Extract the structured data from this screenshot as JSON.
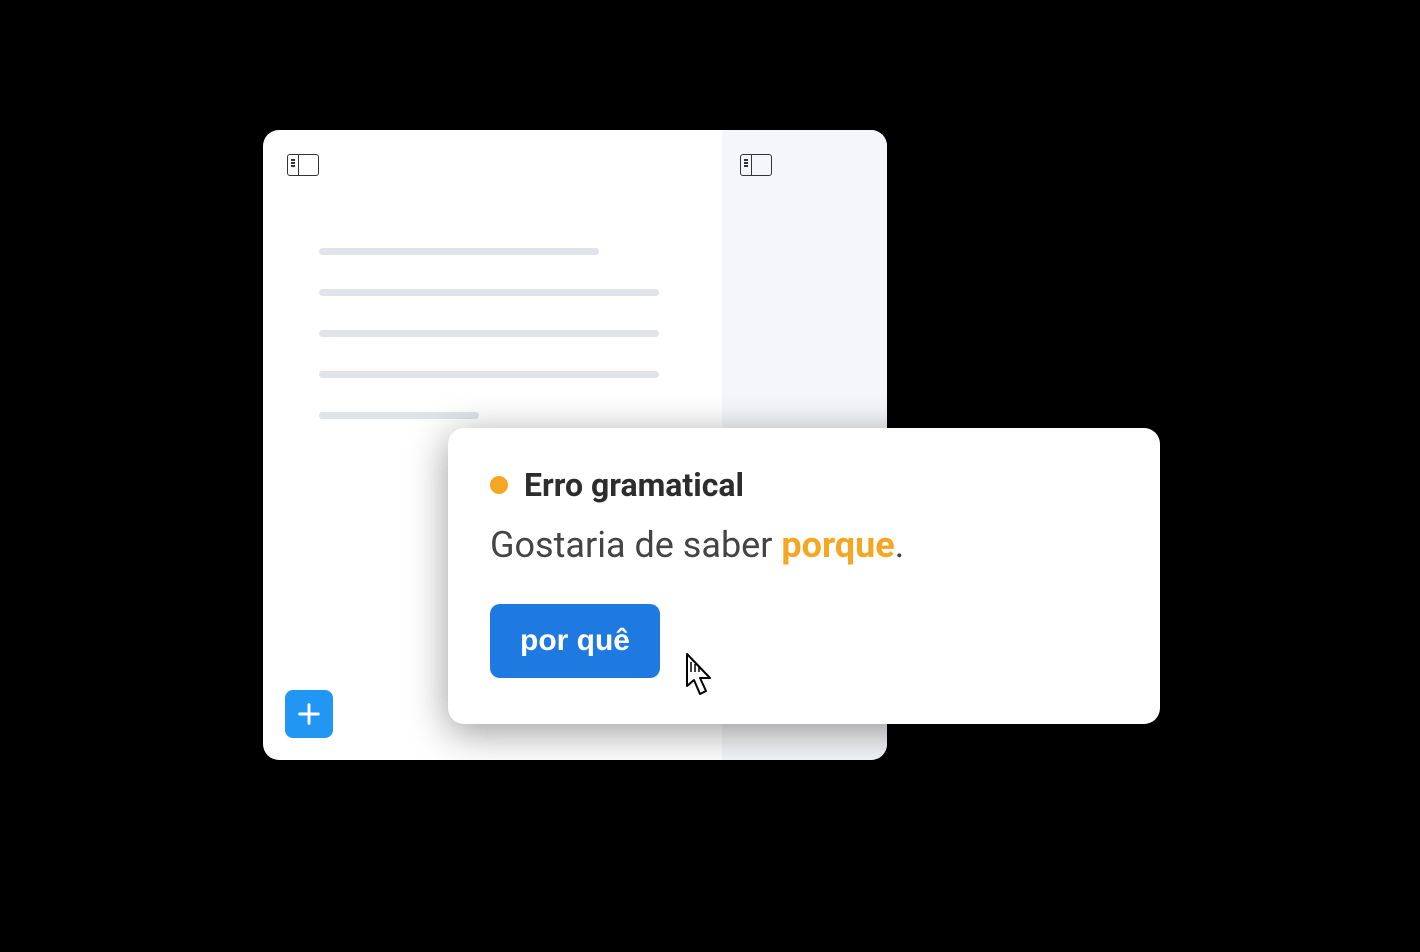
{
  "tooltip": {
    "title": "Erro gramatical",
    "sentence_prefix": "Gostaria de saber ",
    "highlighted_word": "porque",
    "sentence_suffix": ".",
    "suggestion": "por quê"
  },
  "icons": {
    "panel_left": "panel-left-icon",
    "panel_right": "panel-right-icon",
    "add": "plus-icon",
    "cursor": "cursor-pointer-icon"
  },
  "colors": {
    "accent_orange": "#f5a623",
    "accent_blue": "#1e7ae0",
    "add_button_blue": "#2196f3"
  }
}
